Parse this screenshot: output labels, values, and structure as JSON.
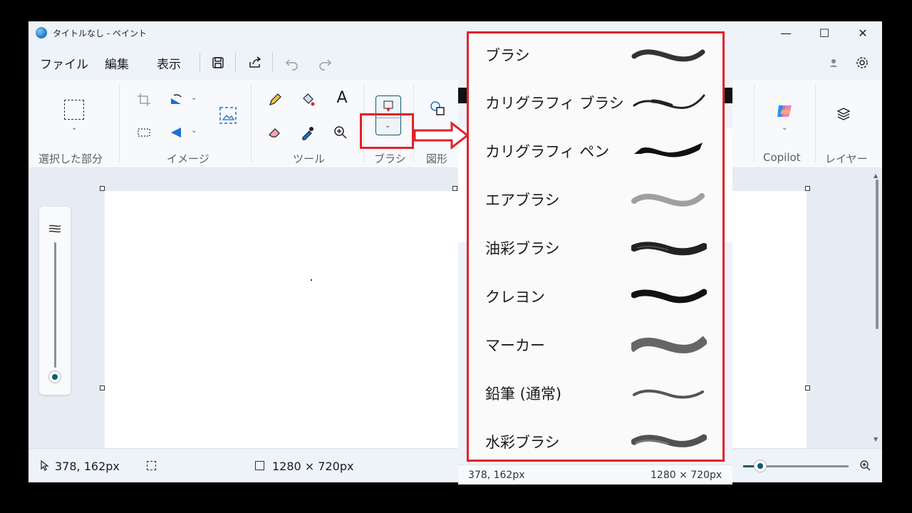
{
  "window": {
    "title": "タイトルなし - ペイント"
  },
  "menu": {
    "file": "ファイル",
    "edit": "編集",
    "view": "表示"
  },
  "ribbon": {
    "groups": {
      "selection": "選択した部分",
      "image": "イメージ",
      "tools": "ツール",
      "brushes": "ブラシ",
      "shapes": "図形",
      "copilot": "Copilot",
      "layers": "レイヤー"
    }
  },
  "status": {
    "cursor_pos": "378, 162px",
    "canvas_size": "1280 × 720px"
  },
  "behind": {
    "cursor_pos": "378, 162px",
    "canvas_size": "1280 × 720px"
  },
  "brush_menu": {
    "items": [
      {
        "label": "ブラシ",
        "style": "brush"
      },
      {
        "label": "カリグラフィ ブラシ",
        "style": "calligraphy-brush"
      },
      {
        "label": "カリグラフィ ペン",
        "style": "calligraphy-pen"
      },
      {
        "label": "エアブラシ",
        "style": "airbrush"
      },
      {
        "label": "油彩ブラシ",
        "style": "oil-brush"
      },
      {
        "label": "クレヨン",
        "style": "crayon"
      },
      {
        "label": "マーカー",
        "style": "marker"
      },
      {
        "label": "鉛筆 (通常)",
        "style": "pencil"
      },
      {
        "label": "水彩ブラシ",
        "style": "watercolor"
      }
    ]
  },
  "colors": {
    "highlight": "#e0222a",
    "accent": "#0f5c70"
  }
}
